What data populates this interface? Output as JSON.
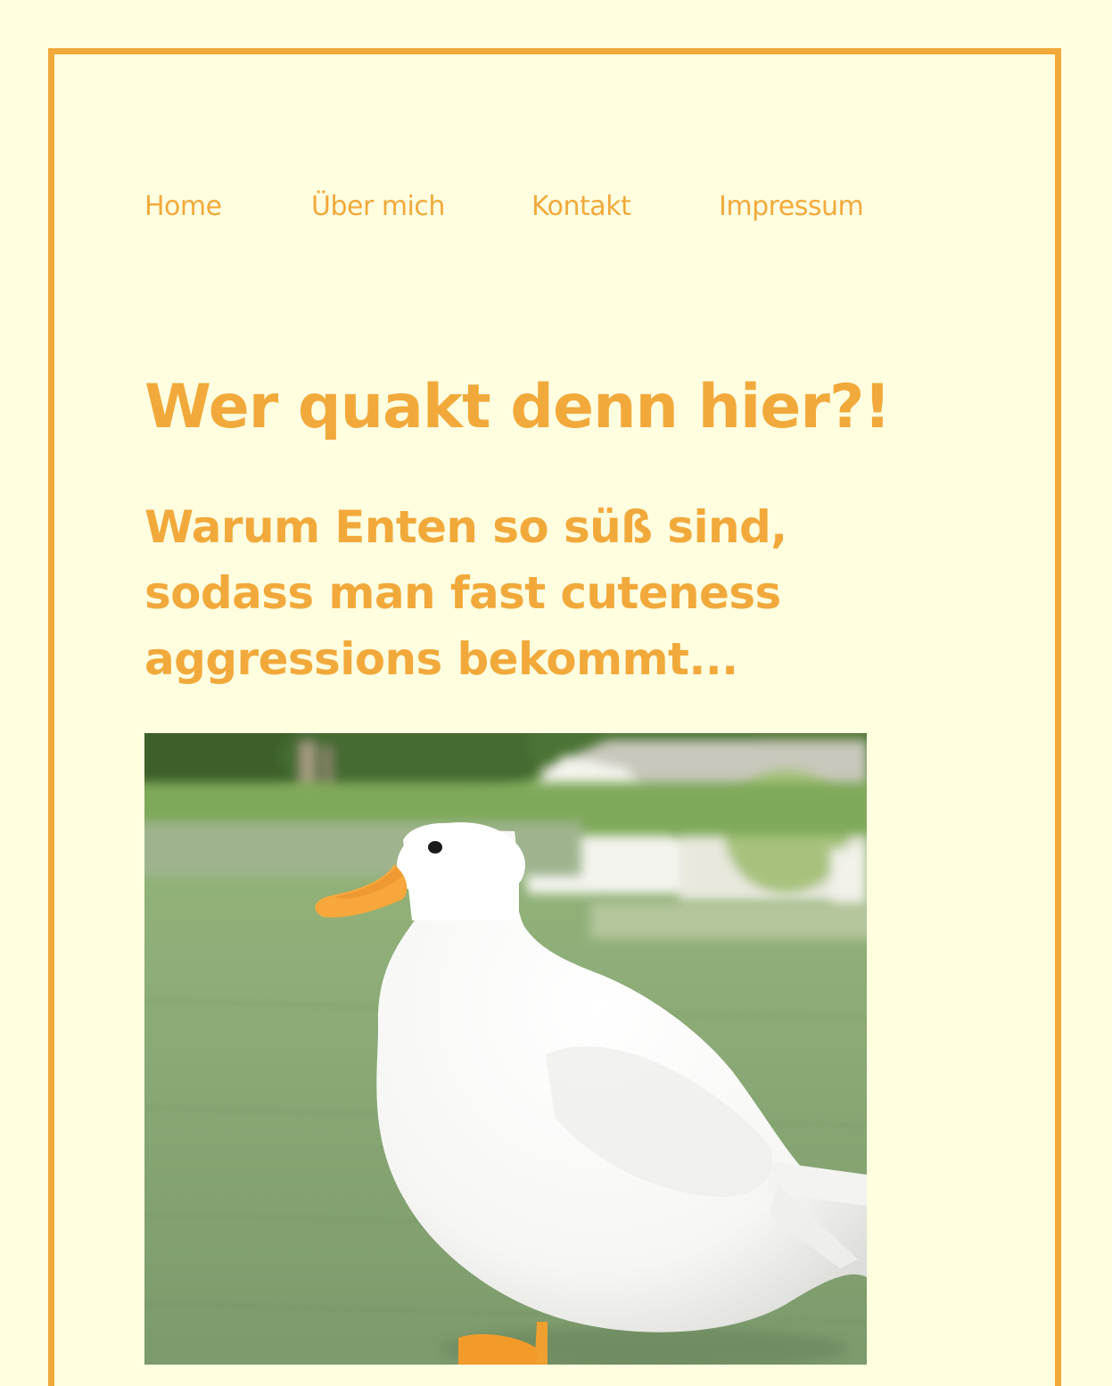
{
  "nav": {
    "items": [
      {
        "label": "Home"
      },
      {
        "label": "Über mich"
      },
      {
        "label": "Kontakt"
      },
      {
        "label": "Impressum"
      }
    ]
  },
  "article": {
    "title": "Wer quakt denn hier?!",
    "subtitle": "Warum Enten so süß sind, sodass man fast cuteness aggressions bekommt..."
  },
  "image": {
    "subject": "white-duck-on-grass"
  },
  "colors": {
    "accent": "#f2a93b",
    "background": "#ffffe0"
  }
}
